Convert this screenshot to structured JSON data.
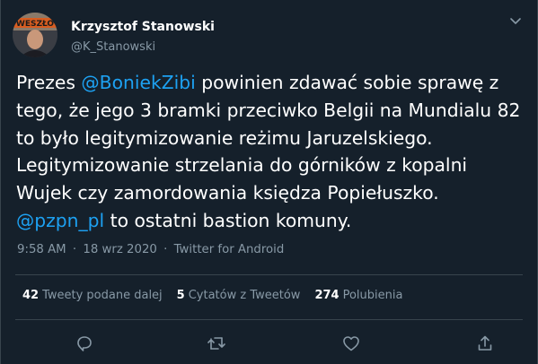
{
  "author": {
    "name": "Krzysztof Stanowski",
    "handle": "@K_Stanowski",
    "avatar_text": "WESZŁO"
  },
  "tweet": {
    "lines": [
      {
        "before": "Prezes ",
        "mention": "@BoniekZibi",
        "after": " powinien zdawać sobie sprawę z"
      },
      {
        "before": "tego, że jego 3 bramki przeciwko Belgii na Mundialu 82",
        "mention": "",
        "after": ""
      },
      {
        "before": "to było legitymizowanie reżimu Jaruzelskiego.",
        "mention": "",
        "after": ""
      },
      {
        "before": "Legitymizowanie strzelania do górników z kopalni",
        "mention": "",
        "after": ""
      },
      {
        "before": "Wujek czy zamordowania księdza Popiełuszko.",
        "mention": "",
        "after": ""
      },
      {
        "before": "",
        "mention": "@pzpn_pl",
        "after": " to ostatni bastion komuny."
      }
    ]
  },
  "meta": {
    "time": "9:58 AM",
    "separator": "·",
    "date": "18 wrz 2020",
    "source": "Twitter for Android"
  },
  "stats": {
    "retweets": {
      "count": "42",
      "label": "Tweety podane dalej"
    },
    "quotes": {
      "count": "5",
      "label": "Cytatów z Tweetów"
    },
    "likes": {
      "count": "274",
      "label": "Polubienia"
    }
  },
  "icons": {
    "more": "chevron-down-icon",
    "reply": "reply-icon",
    "retweet": "retweet-icon",
    "like": "like-icon",
    "share": "share-icon"
  },
  "colors": {
    "background": "#15202b",
    "text": "#ffffff",
    "secondary": "#8899a6",
    "accent": "#1da1f2",
    "divider": "#38444d"
  }
}
